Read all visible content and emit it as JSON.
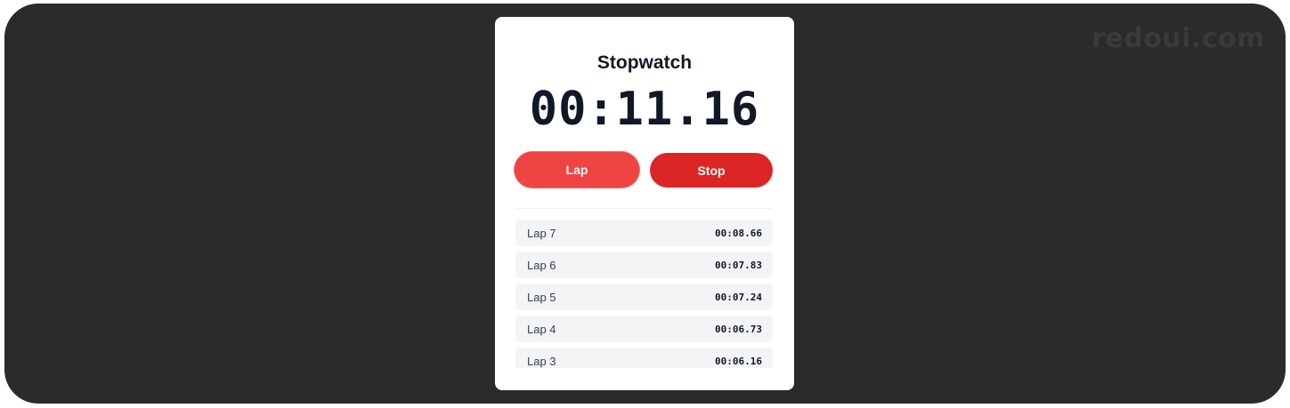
{
  "watermark": "redoui.com",
  "stopwatch": {
    "title": "Stopwatch",
    "time": "00:11.16",
    "lap_label": "Lap",
    "stop_label": "Stop"
  },
  "laps": [
    {
      "name": "Lap 7",
      "time": "00:08.66"
    },
    {
      "name": "Lap 6",
      "time": "00:07.83"
    },
    {
      "name": "Lap 5",
      "time": "00:07.24"
    },
    {
      "name": "Lap 4",
      "time": "00:06.73"
    },
    {
      "name": "Lap 3",
      "time": "00:06.16"
    }
  ],
  "colors": {
    "background": "#2b2b2b",
    "card": "#ffffff",
    "lap_button": "#ef4444",
    "stop_button": "#dc2626",
    "lap_row": "#f3f4f6",
    "text": "#111827"
  }
}
